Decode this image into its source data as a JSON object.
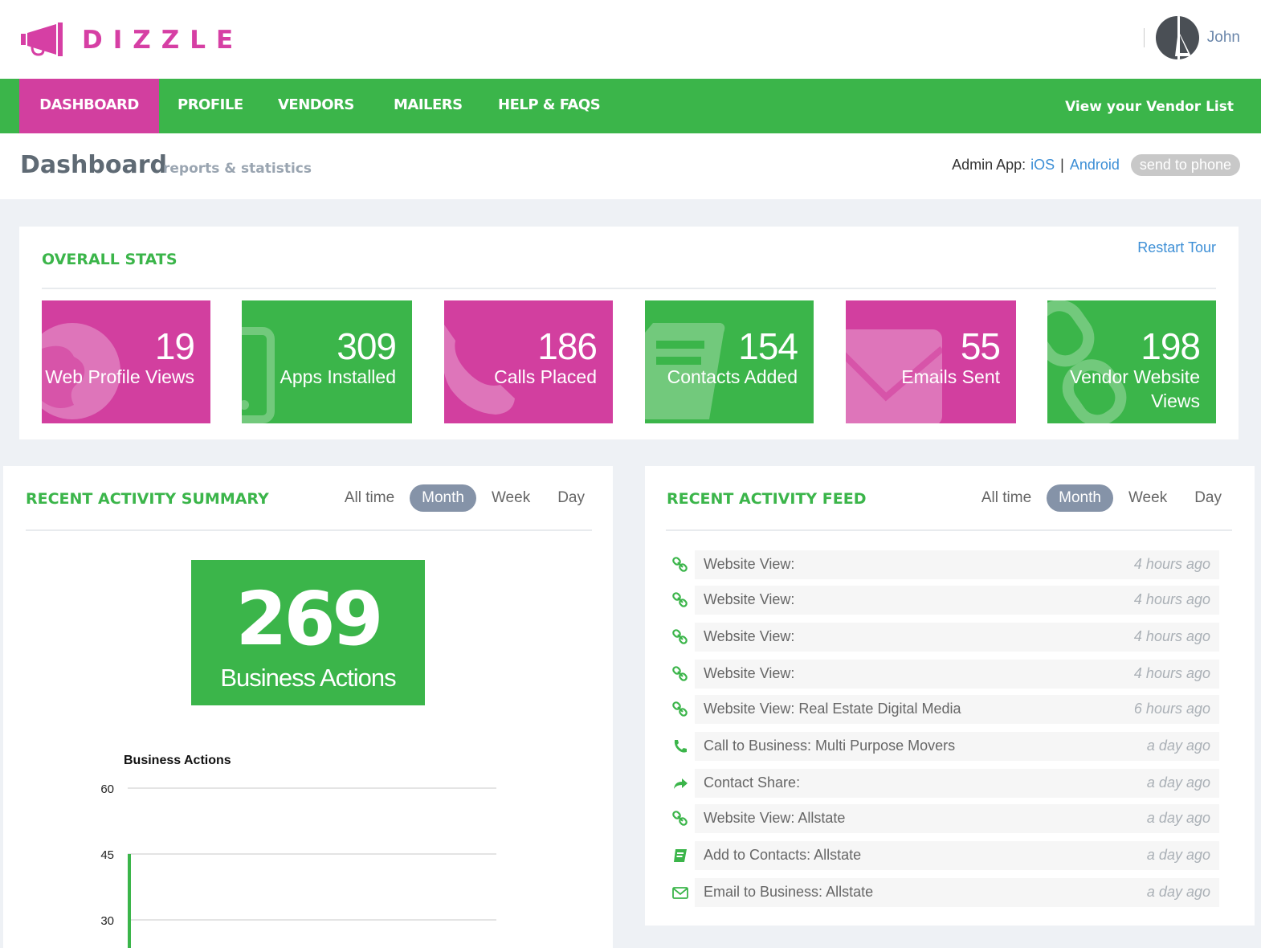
{
  "header": {
    "logo_text": "DIZZLE",
    "user_name": "John"
  },
  "nav": {
    "items": [
      {
        "label": "DASHBOARD",
        "active": true
      },
      {
        "label": "PROFILE",
        "active": false
      },
      {
        "label": "VENDORS",
        "active": false
      },
      {
        "label": "MAILERS",
        "active": false
      },
      {
        "label": "HELP & FAQS",
        "active": false
      }
    ],
    "right_link": "View your Vendor List"
  },
  "title_bar": {
    "title": "Dashboard",
    "subtitle": "reports & statistics",
    "admin_app_label": "Admin App:",
    "ios_link": "iOS",
    "separator": "|",
    "android_link": "Android",
    "send_button": "send to phone"
  },
  "overall_stats": {
    "title": "OVERALL STATS",
    "restart_tour": "Restart Tour",
    "tiles": [
      {
        "value": "19",
        "label": "Web Profile Views",
        "color": "#d23f9f",
        "icon": "globe-icon"
      },
      {
        "value": "309",
        "label": "Apps Installed",
        "color": "#3bb54a",
        "icon": "mobile-icon"
      },
      {
        "value": "186",
        "label": "Calls Placed",
        "color": "#d23f9f",
        "icon": "phone-icon"
      },
      {
        "value": "154",
        "label": "Contacts Added",
        "color": "#3bb54a",
        "icon": "address-book-icon"
      },
      {
        "value": "55",
        "label": "Emails Sent",
        "color": "#d23f9f",
        "icon": "envelope-icon"
      },
      {
        "value": "198",
        "label": "Vendor Website Views",
        "color": "#3bb54a",
        "icon": "link-icon"
      }
    ]
  },
  "summary": {
    "title": "RECENT ACTIVITY SUMMARY",
    "filters": [
      "All time",
      "Month",
      "Week",
      "Day"
    ],
    "active_filter": "Month",
    "big_number": "269",
    "big_label": "Business Actions"
  },
  "chart_data": {
    "type": "line",
    "title": "Business Actions",
    "xlabel": "",
    "ylabel": "",
    "y_ticks": [
      "60",
      "45",
      "30"
    ],
    "grid": true,
    "series": []
  },
  "feed": {
    "title": "RECENT ACTIVITY FEED",
    "filters": [
      "All time",
      "Month",
      "Week",
      "Day"
    ],
    "active_filter": "Month",
    "items": [
      {
        "icon": "link-icon",
        "text": "Website View:",
        "time": "4 hours ago"
      },
      {
        "icon": "link-icon",
        "text": "Website View:",
        "time": "4 hours ago"
      },
      {
        "icon": "link-icon",
        "text": "Website View:",
        "time": "4 hours ago"
      },
      {
        "icon": "link-icon",
        "text": "Website View:",
        "time": "4 hours ago"
      },
      {
        "icon": "link-icon",
        "text": "Website View: Real Estate Digital Media",
        "time": "6 hours ago"
      },
      {
        "icon": "phone-icon",
        "text": "Call to Business: Multi Purpose Movers",
        "time": "a day ago"
      },
      {
        "icon": "share-icon",
        "text": "Contact Share:",
        "time": "a day ago"
      },
      {
        "icon": "link-icon",
        "text": "Website View: Allstate",
        "time": "a day ago"
      },
      {
        "icon": "address-book-icon",
        "text": "Add to Contacts: Allstate",
        "time": "a day ago"
      },
      {
        "icon": "envelope-icon",
        "text": "Email to Business: Allstate",
        "time": "a day ago"
      }
    ]
  },
  "colors": {
    "brand_pink": "#d23f9f",
    "brand_green": "#3bb54a",
    "link_blue": "#3d8fd6",
    "active_filter": "#8593a8"
  }
}
